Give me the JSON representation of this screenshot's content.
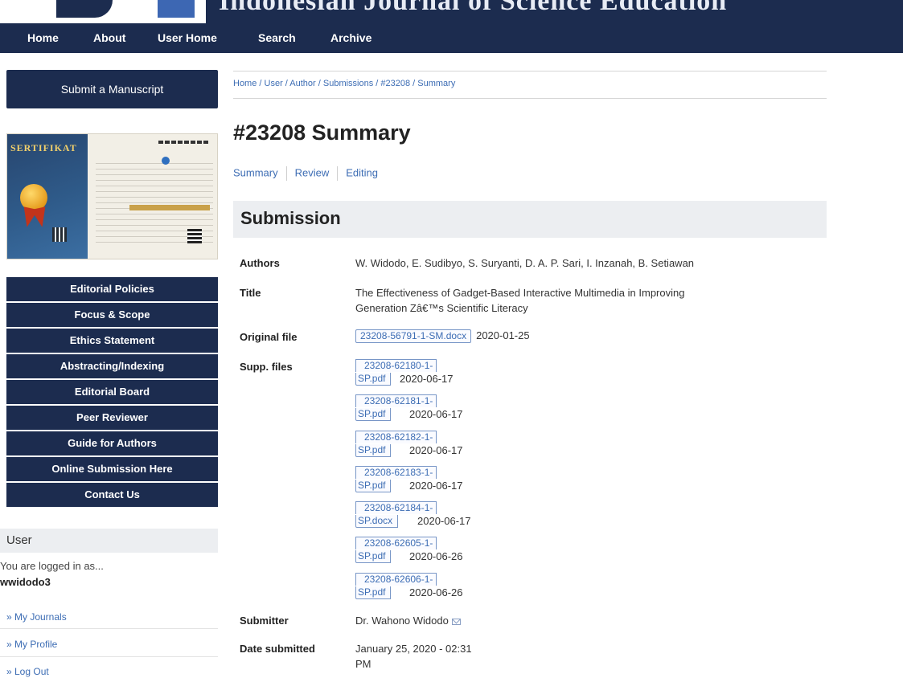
{
  "header": {
    "title": "Indonesian Journal of Science Education"
  },
  "nav": {
    "items": [
      "Home",
      "About",
      "User Home",
      "Search",
      "Archive"
    ]
  },
  "sidebar": {
    "submit_label": "Submit a Manuscript",
    "certificate_title": "SERTIFIKAT",
    "menu": [
      "Editorial Policies",
      "Focus & Scope",
      "Ethics Statement",
      "Abstracting/Indexing",
      "Editorial Board",
      "Peer Reviewer",
      "Guide for Authors",
      "Online Submission Here",
      "Contact Us"
    ],
    "user": {
      "heading": "User",
      "logged_in_text": "You are logged in as...",
      "username": "wwidodo3",
      "links": [
        "» My Journals",
        "» My Profile",
        "» Log Out"
      ]
    }
  },
  "main": {
    "breadcrumb": "Home / User / Author / Submissions / #23208 / Summary",
    "page_title": "#23208 Summary",
    "tabs": [
      "Summary",
      "Review",
      "Editing"
    ],
    "section_title": "Submission",
    "fields": {
      "authors_label": "Authors",
      "authors": "W. Widodo, E. Sudibyo, S. Suryanti, D. A. P. Sari, I. Inzanah, B. Setiawan",
      "title_label": "Title",
      "title_line1": "The Effectiveness of Gadget-Based Interactive Multimedia in Improving",
      "title_line2": "Generation Zâ€™s Scientific Literacy",
      "original_file_label": "Original file",
      "original_file_name": "23208-56791-1-SM.docx",
      "original_file_date": "2020-01-25",
      "supp_files_label": "Supp. files",
      "supp_files": [
        {
          "line1": "23208-62180-1-",
          "line2": "SP.pdf",
          "date": "2020-06-17"
        },
        {
          "line1": "23208-62181-1-",
          "line2": "SP.pdf",
          "date": "2020-06-17"
        },
        {
          "line1": "23208-62182-1-",
          "line2": "SP.pdf",
          "date": "2020-06-17"
        },
        {
          "line1": "23208-62183-1-",
          "line2": "SP.pdf",
          "date": "2020-06-17"
        },
        {
          "line1": "23208-62184-1-",
          "line2": "SP.docx",
          "date": "2020-06-17"
        },
        {
          "line1": "23208-62605-1-",
          "line2": "SP.pdf",
          "date": "2020-06-26"
        },
        {
          "line1": "23208-62606-1-",
          "line2": "SP.pdf",
          "date": "2020-06-26"
        }
      ],
      "submitter_label": "Submitter",
      "submitter": "Dr. Wahono Widodo",
      "date_submitted_label": "Date submitted",
      "date_submitted_line1": "January 25, 2020 - 02:31",
      "date_submitted_line2": "PM"
    }
  },
  "icons": {
    "envelope": "envelope-icon"
  }
}
